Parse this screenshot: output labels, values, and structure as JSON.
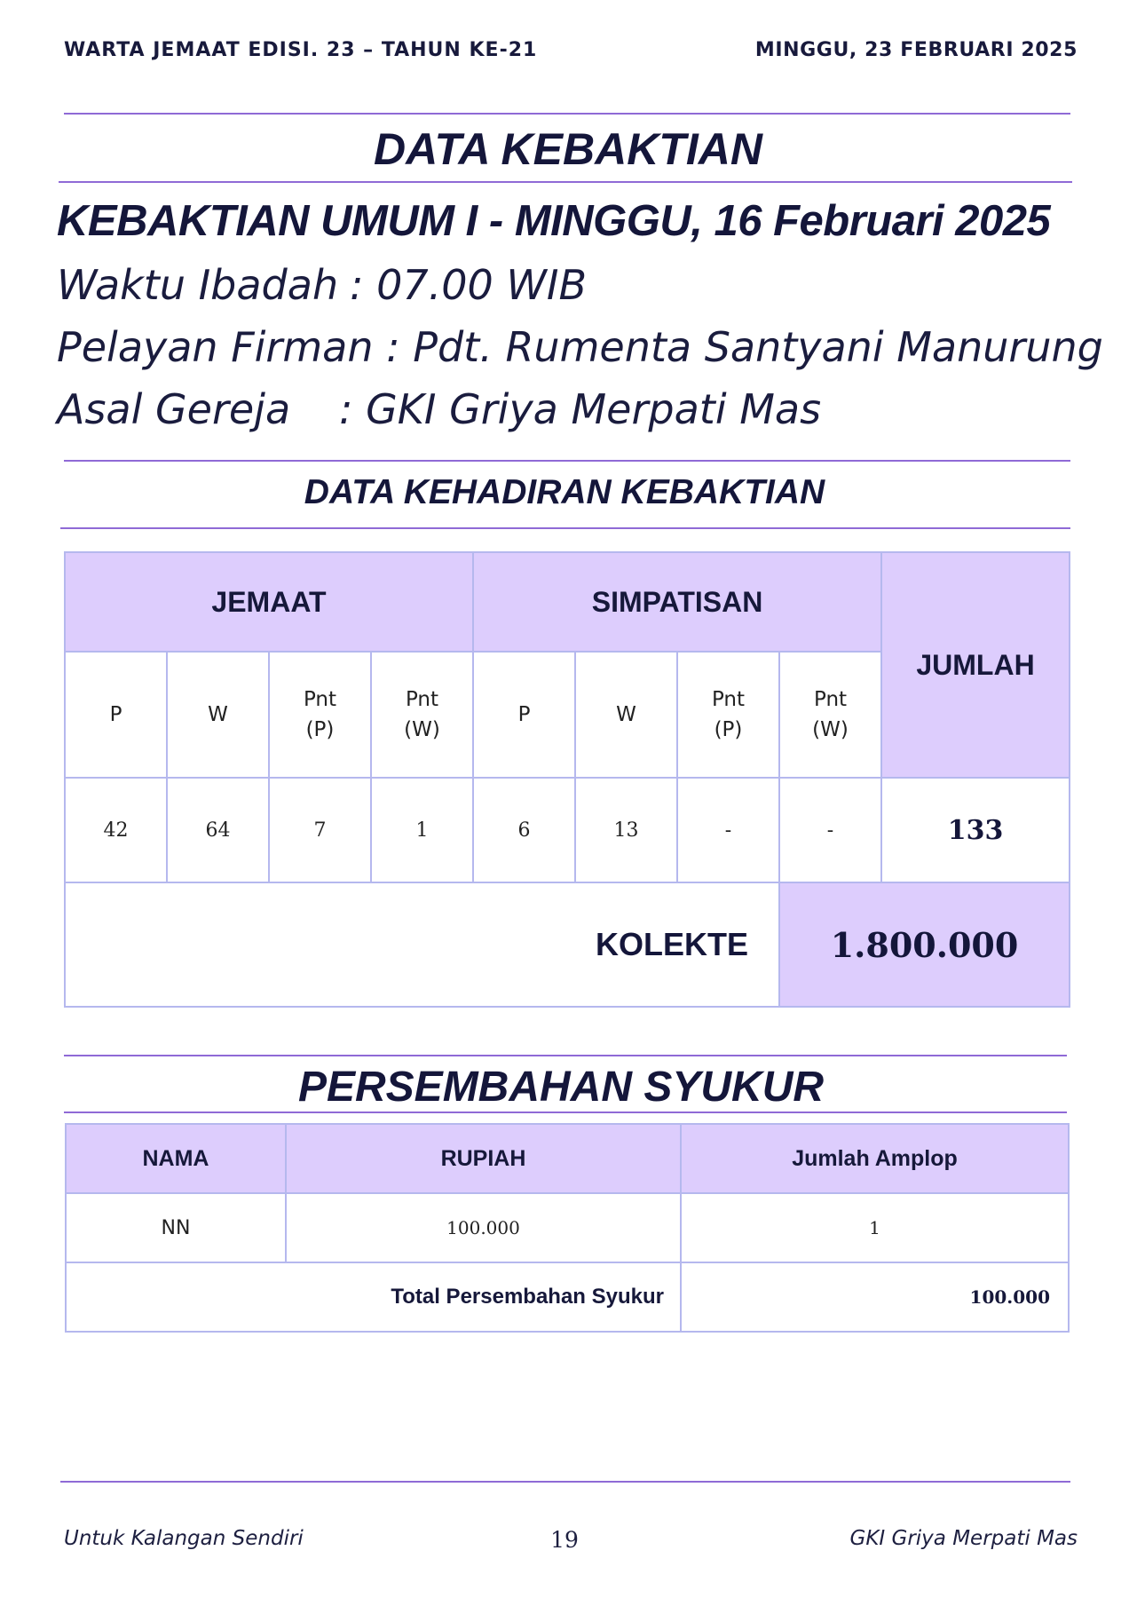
{
  "header": {
    "left": "WARTA JEMAAT EDISI. 23 – TAHUN KE-21",
    "right": "MINGGU, 23 FEBRUARI 2025"
  },
  "section_title": "DATA KEBAKTIAN",
  "service": {
    "title": "KEBAKTIAN UMUM I - MINGGU, 16 Februari 2025",
    "time_label": "Waktu Ibadah",
    "time_value": ": 07.00 WIB",
    "preacher_label": "Pelayan Firman",
    "preacher_value": ": Pdt. Rumenta Santyani Manurung",
    "church_label": "Asal Gereja",
    "church_value": ": GKI Griya Merpati Mas"
  },
  "attendance": {
    "title": "DATA KEHADIRAN KEBAKTIAN",
    "group_jemaat": "JEMAAT",
    "group_simpatisan": "SIMPATISAN",
    "total_header": "JUMLAH",
    "columns": [
      "P",
      "W",
      "Pnt\n(P)",
      "Pnt\n(W)",
      "P",
      "W",
      "Pnt\n(P)",
      "Pnt\n(W)"
    ],
    "values": [
      "42",
      "64",
      "7",
      "1",
      "6",
      "13",
      "-",
      "-"
    ],
    "total": "133",
    "collection_label": "KOLEKTE",
    "collection_value": "1.800.000"
  },
  "offering": {
    "title": "PERSEMBAHAN SYUKUR",
    "headers": {
      "name": "NAMA",
      "amount": "RUPIAH",
      "envelopes": "Jumlah Amplop"
    },
    "rows": [
      {
        "name": "NN",
        "amount": "100.000",
        "envelopes": "1"
      }
    ],
    "total_label": "Total Persembahan Syukur",
    "total_value": "100.000"
  },
  "footer": {
    "left": "Untuk Kalangan Sendiri",
    "page": "19",
    "right": "GKI Griya Merpati Mas"
  },
  "colors": {
    "accent_rule": "#8f6ad6",
    "header_fill": "#ddcdfd",
    "table_border": "#b5b8ee",
    "text": "#14163a"
  }
}
